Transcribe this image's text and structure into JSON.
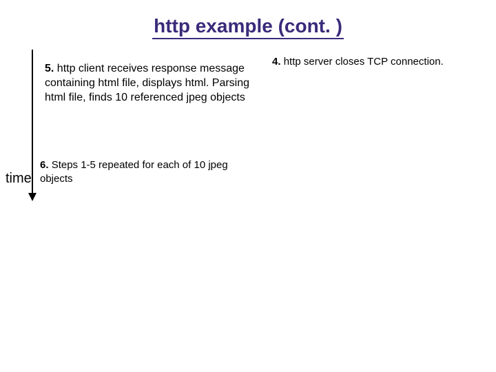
{
  "title": "http example (cont. )",
  "timeLabel": "time",
  "item4": {
    "num": "4.",
    "text": "http server closes TCP connection."
  },
  "item5": {
    "num": "5.",
    "text": "http client receives response message containing html file, displays html.  Parsing html file, finds 10 referenced jpeg objects"
  },
  "item6": {
    "num": "6.",
    "text": "Steps 1-5 repeated for each of 10 jpeg objects"
  }
}
